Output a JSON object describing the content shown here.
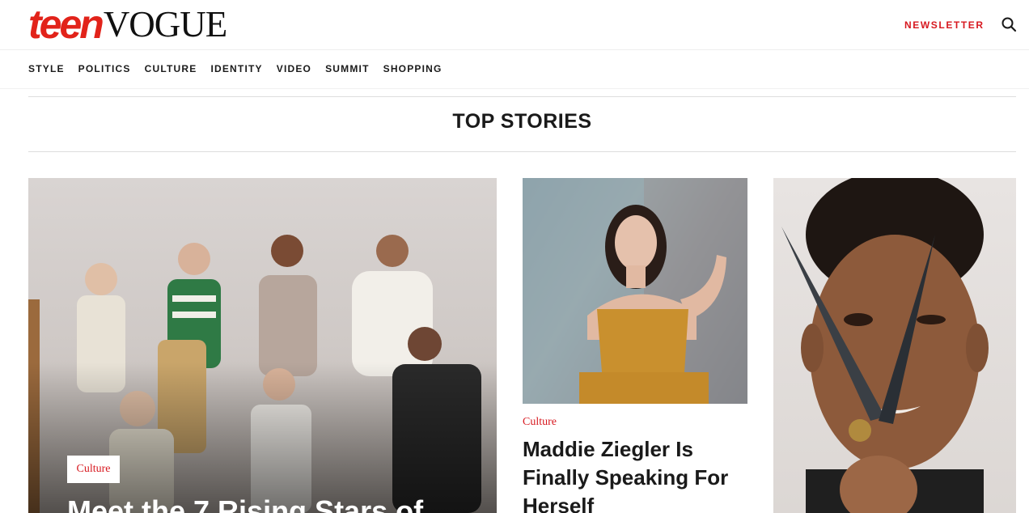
{
  "header": {
    "logo_teen": "teen",
    "logo_vogue": "VOGUE",
    "newsletter_label": "NEWSLETTER",
    "search_icon": "search-icon"
  },
  "nav": {
    "items": [
      "STYLE",
      "POLITICS",
      "CULTURE",
      "IDENTITY",
      "VIDEO",
      "SUMMIT",
      "SHOPPING"
    ]
  },
  "top_stories": {
    "title": "TOP STORIES",
    "cards": [
      {
        "category": "Culture",
        "headline": "Meet the 7 Rising Stars of"
      },
      {
        "category": "Culture",
        "headline": "Maddie Ziegler Is Finally Speaking For Herself"
      },
      {
        "category": "",
        "headline": ""
      }
    ]
  },
  "colors": {
    "brand_red": "#d71920",
    "text_dark": "#1a1a1a"
  }
}
